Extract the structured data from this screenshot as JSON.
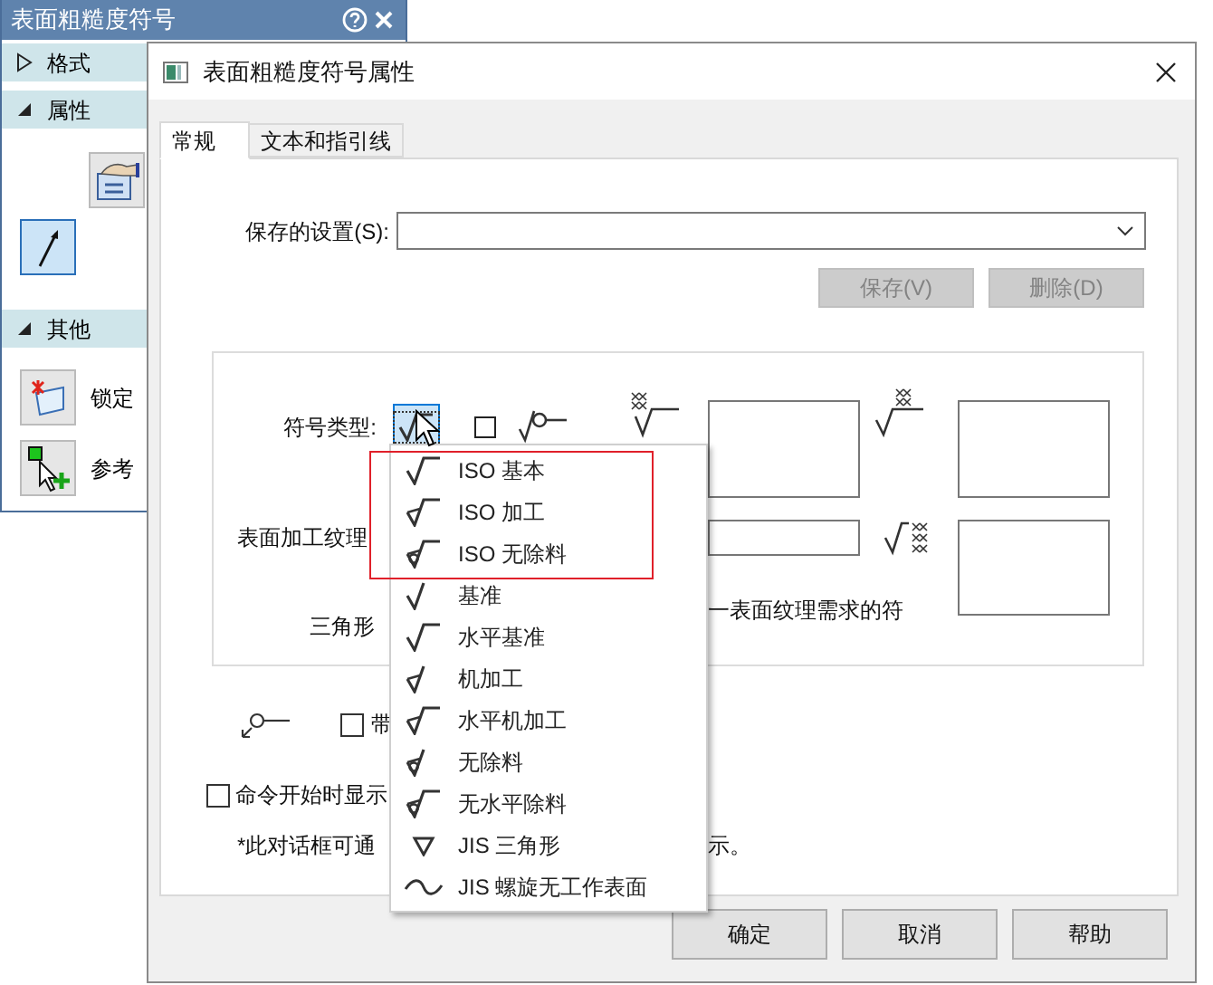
{
  "side_panel": {
    "title": "表面粗糙度符号",
    "sections": [
      {
        "label": "格式",
        "expanded": false
      },
      {
        "label": "属性",
        "expanded": true,
        "tools": [
          {
            "kind": "form",
            "selected": false
          },
          {
            "kind": "arrow",
            "selected": true
          }
        ]
      },
      {
        "label": "其他",
        "expanded": true,
        "items": [
          {
            "kind": "lock",
            "label": "锁定"
          },
          {
            "kind": "pick",
            "label": "参考"
          }
        ]
      }
    ]
  },
  "dialog": {
    "title": "表面粗糙度符号属性",
    "tabs": [
      {
        "label": "常规",
        "selected": true
      },
      {
        "label": "文本和指引线",
        "selected": false
      }
    ],
    "saved_settings": {
      "label": "保存的设置(S):"
    },
    "setting_buttons": [
      {
        "label": "保存(V)",
        "disabled": true
      },
      {
        "label": "删除(D)",
        "disabled": true
      }
    ],
    "symbol_type_label": "符号类型:",
    "texture_label": "表面加工纹理",
    "triangle_label": "三角形",
    "texture_note": "一表面纹理需求的符",
    "leader_checkbox": {
      "label": "带",
      "checked": false
    },
    "show_checkbox": {
      "label": "命令开始时显示",
      "checked": false
    },
    "footnote": [
      "*此对话框可通",
      "示。"
    ],
    "buttons": [
      "确定",
      "取消",
      "帮助"
    ]
  },
  "symbol_menu": {
    "items": [
      {
        "kind": "iso_basic",
        "label": "ISO 基本",
        "highlighted": true
      },
      {
        "kind": "iso_machined",
        "label": "ISO 加工",
        "highlighted": true
      },
      {
        "kind": "iso_no_removal",
        "label": "ISO 无除料",
        "highlighted": true
      },
      {
        "kind": "datum",
        "label": "基准",
        "highlighted": false
      },
      {
        "kind": "horizontal_datum",
        "label": "水平基准",
        "highlighted": false
      },
      {
        "kind": "machined",
        "label": "机加工",
        "highlighted": false
      },
      {
        "kind": "horizontal_machined",
        "label": "水平机加工",
        "highlighted": false
      },
      {
        "kind": "no_removal",
        "label": "无除料",
        "highlighted": false
      },
      {
        "kind": "horizontal_no_removal",
        "label": "无水平除料",
        "highlighted": false
      },
      {
        "kind": "jis_triangle",
        "label": "JIS 三角形",
        "highlighted": false
      },
      {
        "kind": "jis_wavy",
        "label": "JIS 螺旋无工作表面",
        "highlighted": false
      }
    ]
  }
}
